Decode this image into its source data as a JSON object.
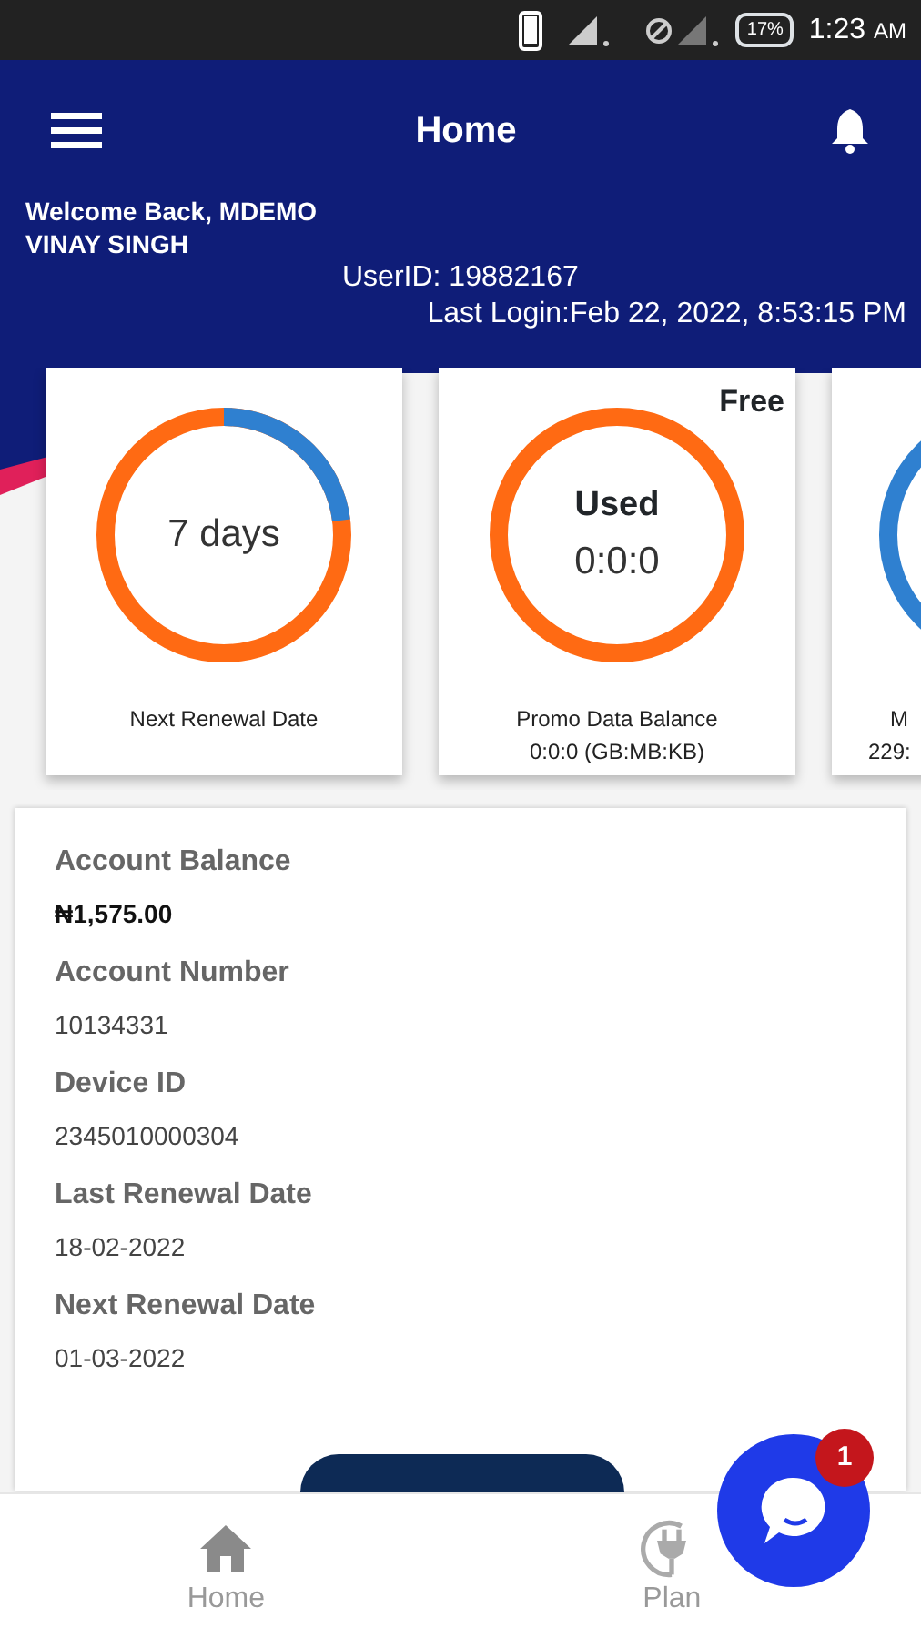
{
  "status_bar": {
    "battery": "17%",
    "time": "1:23",
    "ampm": "AM"
  },
  "app_bar": {
    "title": "Home"
  },
  "welcome": {
    "greeting": "Welcome Back, MDEMO",
    "name": "VINAY SINGH",
    "user_id": "UserID: 19882167",
    "last_login": "Last Login:Feb 22, 2022, 8:53:15 PM"
  },
  "gauges": [
    {
      "center": "7 days",
      "level": 0.23,
      "label": "Next Renewal Date"
    },
    {
      "corner": "Free",
      "heading": "Used",
      "center": "0:0:0",
      "level": 0,
      "label": "Promo Data Balance",
      "sub": "0:0:0 (GB:MB:KB)"
    },
    {
      "color": "#2f80d0",
      "label": "M",
      "sub": "229:"
    }
  ],
  "account": [
    {
      "label": "Account Balance",
      "value": "₦1,575.00",
      "bold": true
    },
    {
      "label": "Account Number",
      "value": "10134331",
      "bold": false
    },
    {
      "label": "Device ID",
      "value": "2345010000304",
      "bold": false
    },
    {
      "label": "Last Renewal Date",
      "value": "18-02-2022",
      "bold": false
    },
    {
      "label": "Next Renewal Date",
      "value": "01-03-2022",
      "bold": false
    }
  ],
  "chat": {
    "badge": "1"
  },
  "bottom_nav": [
    {
      "label": "Home",
      "kind": "home"
    },
    {
      "label": "Plan",
      "kind": "plug"
    }
  ]
}
